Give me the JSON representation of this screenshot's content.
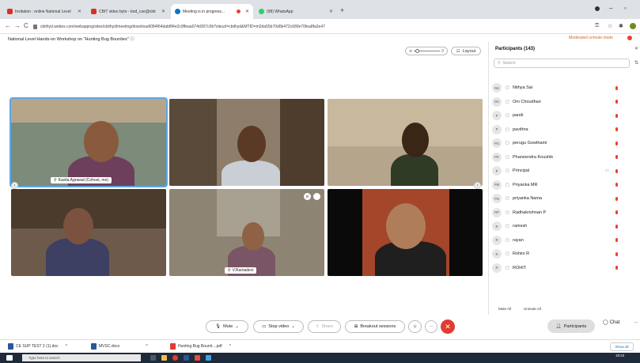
{
  "browser": {
    "tabs": [
      {
        "label": "Invitation : online National Level",
        "favicon_color": "#d93025"
      },
      {
        "label": "CBIT video byte - bod_cse@cbit",
        "favicon_color": "#d93025"
      },
      {
        "label": "Meeting is in progress...",
        "favicon_color": "#0b74c4",
        "active": true
      },
      {
        "label": "(98) WhatsApp",
        "favicon_color": "#25d366"
      }
    ],
    "url": "cbithyd.webex.com/webappng/sites/cbithyd/meeting/download/084f64dab8f4e2c9ffeaa074d307c0b?siteurl=cbithyd&MTID=m2da55b70d0b472c680e70fea8fa2e47"
  },
  "meeting": {
    "title": "National Level Hands-on Workshop on \"Hunting Bug Bounties\"",
    "moderated_mode": "Moderated unmute mode",
    "layout_label": "Layout",
    "slider_value": "0"
  },
  "videos": [
    {
      "name": "Kavita Agrawal (Cohost, me)",
      "show_tag": true
    },
    {
      "name": "",
      "show_tag": false
    },
    {
      "name": "",
      "show_tag": false
    },
    {
      "name": "",
      "show_tag": false
    },
    {
      "name": "V.Ramadevi",
      "show_tag": true
    },
    {
      "name": "",
      "show_tag": false
    }
  ],
  "controls": {
    "mute": "Mute",
    "stop_video": "Stop video",
    "share": "Share",
    "breakout": "Breakout sessions",
    "participants": "Participants",
    "chat": "Chat"
  },
  "participants_panel": {
    "title": "Participants (143)",
    "search_placeholder": "Search",
    "mute_all": "Mute All",
    "unmute_all": "Unmute All",
    "list": [
      {
        "initials": "NS",
        "name": "Nithya Sai"
      },
      {
        "initials": "OC",
        "name": "Om Choudhari"
      },
      {
        "initials": "P",
        "name": "pandi"
      },
      {
        "initials": "P",
        "name": "pavithra"
      },
      {
        "initials": "PG",
        "name": "perugu Gowthami"
      },
      {
        "initials": "PK",
        "name": "Phaneendra Koushik"
      },
      {
        "initials": "P",
        "name": "Principal"
      },
      {
        "initials": "PM",
        "name": "Priyanka MR"
      },
      {
        "initials": "PN",
        "name": "priyanka Nama"
      },
      {
        "initials": "RP",
        "name": "Radhakrishnan P"
      },
      {
        "initials": "R",
        "name": "ramesh"
      },
      {
        "initials": "R",
        "name": "rayan"
      },
      {
        "initials": "R",
        "name": "Rohini R"
      },
      {
        "initials": "R",
        "name": "ROHIT"
      }
    ]
  },
  "downloads": {
    "items": [
      {
        "label": "CE SUP TEST 2 (1).doc",
        "color": "#2b579a"
      },
      {
        "label": "MVSC.docx",
        "color": "#2b579a"
      },
      {
        "label": "Hunting Bug Bounti....pdf",
        "color": "#e53935"
      }
    ],
    "show_all": "Show all"
  },
  "taskbar": {
    "search_placeholder": "Type here to search",
    "time": "19:22"
  }
}
